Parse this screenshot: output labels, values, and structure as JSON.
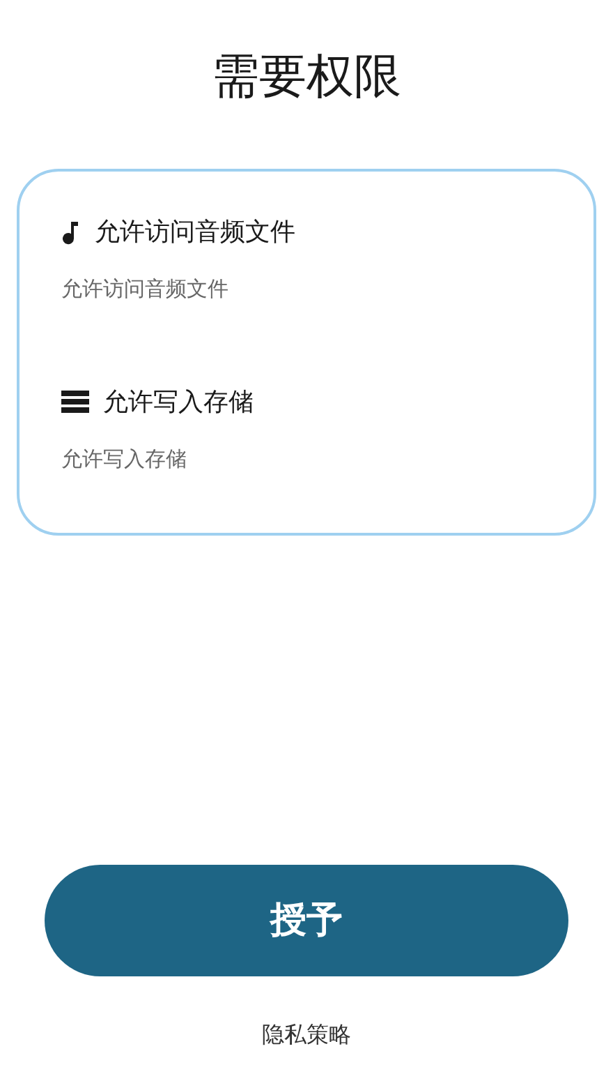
{
  "title": "需要权限",
  "permissions": [
    {
      "kind": "audio",
      "name": "允许访问音频文件",
      "description": "允许访问音频文件"
    },
    {
      "kind": "storage",
      "name": "允许写入存储",
      "description": "允许写入存储"
    }
  ],
  "grant_button": "授予",
  "privacy_link": "隐私策略"
}
